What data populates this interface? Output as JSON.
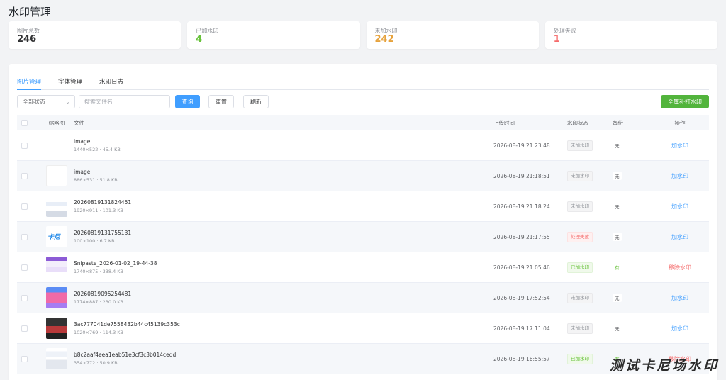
{
  "page_title": "水印管理",
  "stats": [
    {
      "label": "图片总数",
      "value": "246",
      "color": "#303133"
    },
    {
      "label": "已加水印",
      "value": "4",
      "color": "#67c23a"
    },
    {
      "label": "未加水印",
      "value": "242",
      "color": "#e6a23c"
    },
    {
      "label": "处理失败",
      "value": "1",
      "color": "#f56c6c"
    }
  ],
  "tabs": [
    {
      "label": "图片管理",
      "active": true
    },
    {
      "label": "字体管理",
      "active": false
    },
    {
      "label": "水印日志",
      "active": false
    }
  ],
  "toolbar": {
    "status_select": "全部状态",
    "search_placeholder": "搜索文件名",
    "query_label": "查询",
    "reset_label": "重置",
    "refresh_label": "刷新",
    "fill_label": "全库补打水印"
  },
  "table": {
    "headers": {
      "thumb": "缩略图",
      "file": "文件",
      "time": "上传时间",
      "status": "水印状态",
      "backup": "备份",
      "action": "操作"
    },
    "rows": [
      {
        "name": "image",
        "meta": "1440×522 · 45.4 KB",
        "time": "2026-08-19 21:23:48",
        "status": "未加水印",
        "status_type": "none",
        "backup": "无",
        "action": "加水印",
        "action_type": "add",
        "thumb": "blank"
      },
      {
        "name": "image",
        "meta": "886×531 · 51.8 KB",
        "time": "2026-08-19 21:18:51",
        "status": "未加水印",
        "status_type": "none",
        "backup": "无",
        "action": "加水印",
        "action_type": "add",
        "thumb": "doc"
      },
      {
        "name": "20260819131824451",
        "meta": "1920×911 · 101.3 KB",
        "time": "2026-08-19 21:18:24",
        "status": "未加水印",
        "status_type": "none",
        "backup": "无",
        "action": "加水印",
        "action_type": "add",
        "thumb": "ui"
      },
      {
        "name": "20260819131755131",
        "meta": "100×100 · 6.7 KB",
        "time": "2026-08-19 21:17:55",
        "status": "处理失败",
        "status_type": "fail",
        "backup": "无",
        "action": "加水印",
        "action_type": "add",
        "thumb": "logo"
      },
      {
        "name": "Snipaste_2026-01-02_19-44-38",
        "meta": "1740×875 · 338.4 KB",
        "time": "2026-08-19 21:05:46",
        "status": "已加水印",
        "status_type": "ok",
        "backup": "有",
        "action": "移除水印",
        "action_type": "remove",
        "thumb": "purple"
      },
      {
        "name": "20260819095254481",
        "meta": "1774×887 · 230.0 KB",
        "time": "2026-08-19 17:52:54",
        "status": "未加水印",
        "status_type": "none",
        "backup": "无",
        "action": "加水印",
        "action_type": "add",
        "thumb": "pink"
      },
      {
        "name": "3ac777041de7558432b44c45139c353c",
        "meta": "1020×769 · 114.3 KB",
        "time": "2026-08-19 17:11:04",
        "status": "未加水印",
        "status_type": "none",
        "backup": "无",
        "action": "加水印",
        "action_type": "add",
        "thumb": "dark"
      },
      {
        "name": "b8c2aaf4eea1eab51e3cf3c3b014cedd",
        "meta": "354×772 · 50.9 KB",
        "time": "2026-08-19 16:55:57",
        "status": "已加水印",
        "status_type": "ok",
        "backup": "有",
        "action": "移除水印",
        "action_type": "remove",
        "thumb": "mobile"
      }
    ]
  },
  "watermark_text": "测试卡尼场水印"
}
